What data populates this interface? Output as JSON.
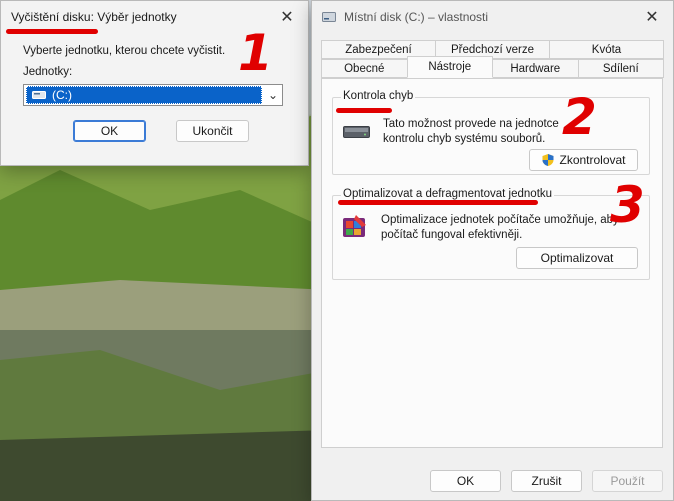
{
  "cleanup_dialog": {
    "title": "Vyčištění disku: Výběr jednotky",
    "description": "Vyberte jednotku, kterou chcete vyčistit.",
    "drives_label": "Jednotky:",
    "selected_drive": "(C:)",
    "ok_label": "OK",
    "cancel_label": "Ukončit"
  },
  "properties_dialog": {
    "title": "Místní disk (C:) – vlastnosti",
    "tabs_row1": [
      "Zabezpečení",
      "Předchozí verze",
      "Kvóta"
    ],
    "tabs_row2": [
      "Obecné",
      "Nástroje",
      "Hardware",
      "Sdílení"
    ],
    "active_tab": "Nástroje",
    "error_check": {
      "title": "Kontrola chyb",
      "text_line1": "Tato možnost provede na jednotce",
      "text_line2": "kontrolu chyb systému souborů.",
      "button": "Zkontrolovat"
    },
    "optimize": {
      "title": "Optimalizovat a defragmentovat jednotku",
      "text_line1": "Optimalizace jednotek počítače umožňuje, aby",
      "text_line2": "počítač fungoval efektivněji.",
      "button": "Optimalizovat"
    },
    "footer": {
      "ok": "OK",
      "cancel": "Zrušit",
      "apply": "Použít"
    }
  },
  "annotations": {
    "n1": "1",
    "n2": "2",
    "n3": "3"
  },
  "colors": {
    "accent": "#0a63c9",
    "annotation": "#e00000",
    "window_bg": "#f3f3f3"
  },
  "icons": [
    "close-icon",
    "chevron-down-icon",
    "drive-icon",
    "hdd-icon",
    "shield-icon",
    "defrag-icon"
  ]
}
